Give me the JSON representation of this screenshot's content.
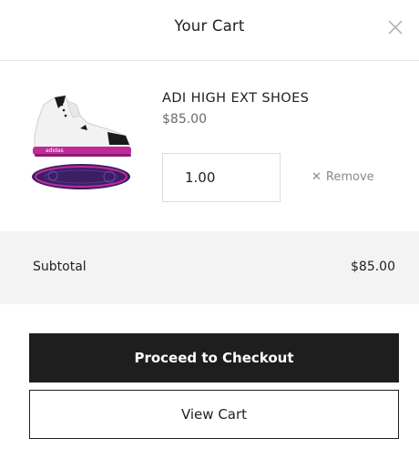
{
  "header": {
    "title": "Your Cart",
    "close_icon": "close-icon"
  },
  "cart": {
    "items": [
      {
        "name": "ADI HIGH EXT SHOES",
        "price": "$85.00",
        "quantity": "1.00",
        "remove_label": "Remove",
        "remove_icon": "x-icon",
        "image": "high-top-sneaker-image",
        "colors": {
          "upper": "#f1f1f1",
          "accent": "#c02a9a",
          "sole": "#3b1e63"
        }
      }
    ]
  },
  "summary": {
    "subtotal_label": "Subtotal",
    "subtotal_value": "$85.00"
  },
  "actions": {
    "checkout_label": "Proceed to Checkout",
    "view_cart_label": "View Cart"
  },
  "colors": {
    "dark_button": "#1e1e1e",
    "subtotal_bg": "#f3f3f3",
    "muted_text": "#6b6b6b"
  }
}
